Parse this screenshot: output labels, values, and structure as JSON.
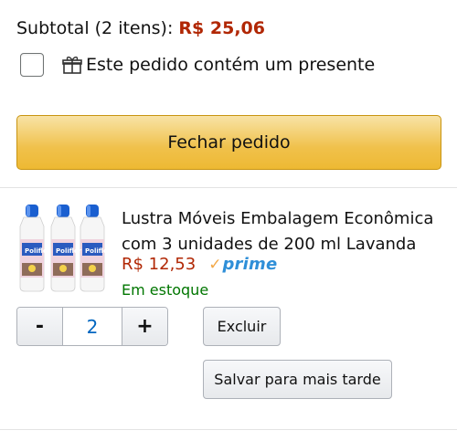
{
  "cart": {
    "subtotal_label": "Subtotal (2 itens):",
    "subtotal_amount": "R$ 25,06",
    "gift_label": "Este pedido contém um presente",
    "gift_checked": false,
    "checkout_label": "Fechar pedido"
  },
  "item": {
    "title": "Lustra Móveis Embalagem Econômica com 3 unidades de 200 ml Lavanda",
    "price": "R$ 12,53",
    "prime_label": "prime",
    "stock": "Em estoque",
    "quantity": "2",
    "minus_label": "-",
    "plus_label": "+",
    "delete_label": "Excluir",
    "save_later_label": "Salvar para mais tarde",
    "image_brand": "Poliflor"
  },
  "colors": {
    "price": "#B12704",
    "stock": "#007600",
    "prime": "#2f8fd8",
    "checkout_button": "#f0c14b",
    "quantity_value": "#0066c0"
  },
  "icons": {
    "gift": "gift-icon",
    "prime_check": "check-icon"
  }
}
